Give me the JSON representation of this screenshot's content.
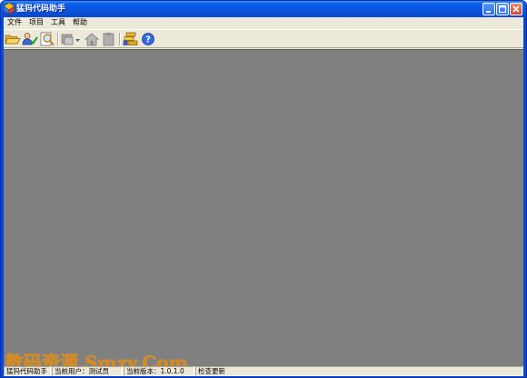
{
  "window": {
    "title": "猛犸代码助手",
    "controls": [
      "minimize",
      "maximize",
      "close"
    ]
  },
  "menu": {
    "items": [
      "文件",
      "项目",
      "工具",
      "帮助"
    ]
  },
  "toolbar": {
    "buttons": [
      {
        "icon": "open-folder-icon"
      },
      {
        "icon": "user-check-icon"
      },
      {
        "icon": "search-document-icon"
      },
      {
        "icon": "build-dropdown-icon"
      },
      {
        "icon": "home-icon"
      },
      {
        "icon": "clipboard-icon"
      },
      {
        "icon": "database-stack-icon"
      },
      {
        "icon": "help-icon"
      }
    ]
  },
  "workspace": {
    "background": "#808080",
    "watermark": "数码资源 Smzy.Com",
    "watermark_color": "#d88818"
  },
  "statusbar": {
    "app_name": "猛犸代码助手",
    "current_user": "当前用户：测试员",
    "current_version": "当前版本：1.0.1.0",
    "check_update": "检查更新"
  },
  "colors": {
    "title_bar": "#0a55e0",
    "chrome": "#ece9d8"
  }
}
